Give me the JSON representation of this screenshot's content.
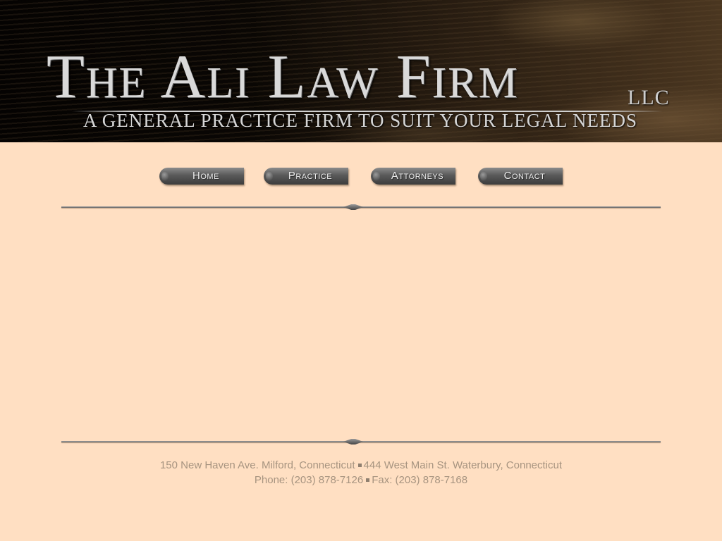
{
  "header": {
    "title": "The Ali Law Firm",
    "suffix": "LLC",
    "tagline": "A GENERAL PRACTICE FIRM TO SUIT YOUR LEGAL NEEDS"
  },
  "nav": {
    "items": [
      {
        "label": "Home"
      },
      {
        "label": "Practice"
      },
      {
        "label": "Attorneys"
      },
      {
        "label": "Contact"
      }
    ]
  },
  "footer": {
    "address_milford": "150 New Haven Ave. Milford, Connecticut",
    "address_waterbury": "444 West Main St. Waterbury, Connecticut",
    "phone": "Phone: (203) 878-7126",
    "fax": "Fax: (203) 878-7168"
  },
  "colors": {
    "background": "#ffdfc2",
    "footer_text": "#a79480",
    "button": "#5a5a5a"
  }
}
